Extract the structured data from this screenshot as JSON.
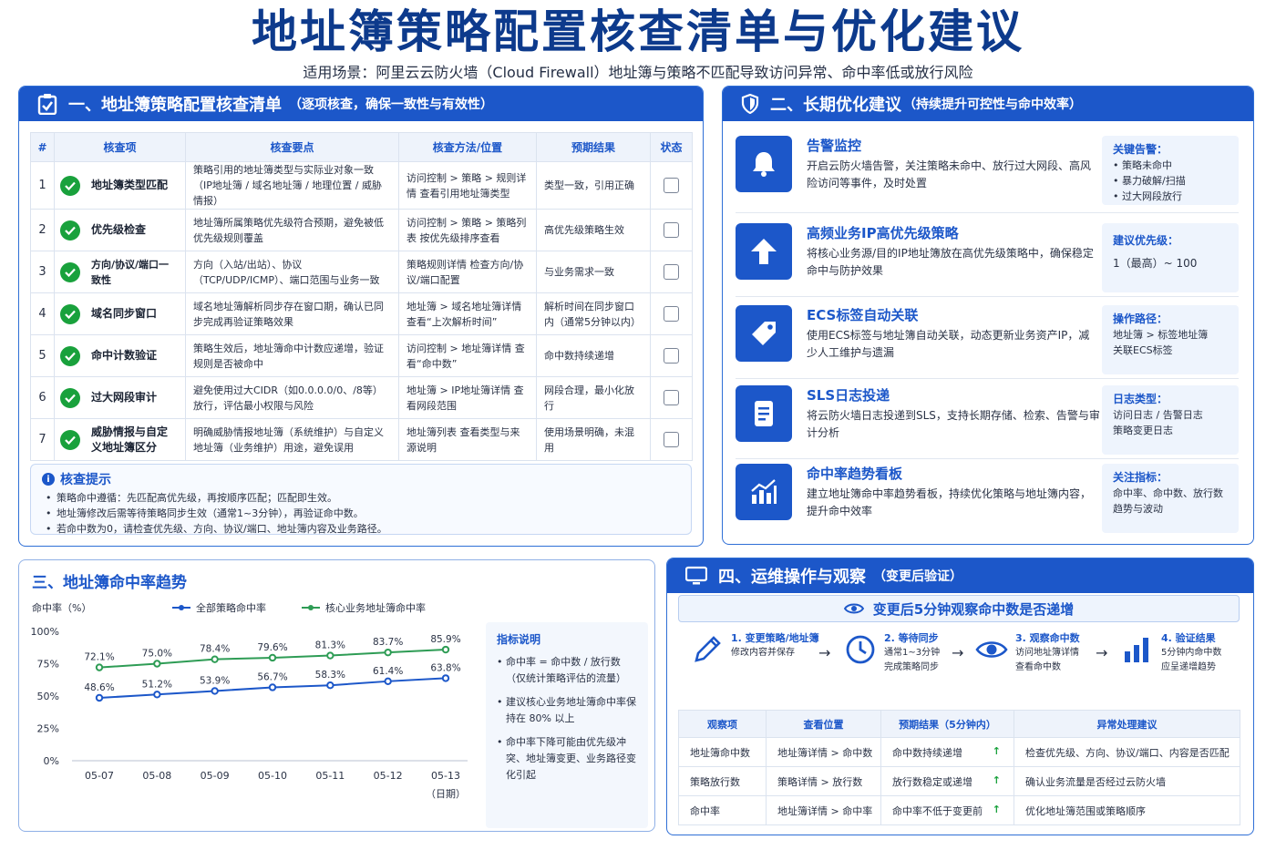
{
  "header": {
    "title": "地址簿策略配置核查清单与优化建议",
    "subtitle": "适用场景：阿里云云防火墙（Cloud Firewall）地址簿与策略不匹配导致访问异常、命中率低或放行风险"
  },
  "checklist": {
    "title": "一、地址簿策略配置核查清单",
    "title_sub": "（逐项核查，确保一致性与有效性）",
    "columns": [
      "#",
      "核查项",
      "核查要点",
      "核查方法/位置",
      "预期结果",
      "状态"
    ],
    "rows": [
      {
        "num": "1",
        "item": "地址簿类型匹配",
        "point": "策略引用的地址簿类型与实际业对象一致（IP地址簿 / 域名地址簿 / 地理位置 / 威胁情报）",
        "method": "访问控制 > 策略 > 规则详情 查看引用地址簿类型",
        "expect": "类型一致，引用正确"
      },
      {
        "num": "2",
        "item": "优先级检查",
        "point": "地址簿所属策略优先级符合预期，避免被低优先级规则覆盖",
        "method": "访问控制 > 策略 > 策略列表 按优先级排序查看",
        "expect": "高优先级策略生效"
      },
      {
        "num": "3",
        "item": "方向/协议/端口一致性",
        "point": "方向（入站/出站）、协议（TCP/UDP/ICMP）、端口范围与业务一致",
        "method": "策略规则详情 检查方向/协议/端口配置",
        "expect": "与业务需求一致"
      },
      {
        "num": "4",
        "item": "域名同步窗口",
        "point": "域名地址簿解析同步存在窗口期，确认已同步完成再验证策略效果",
        "method": "地址簿 > 域名地址簿详情 查看“上次解析时间”",
        "expect": "解析时间在同步窗口内（通常5分钟以内）"
      },
      {
        "num": "5",
        "item": "命中计数验证",
        "point": "策略生效后，地址簿命中计数应递增，验证规则是否被命中",
        "method": "访问控制 > 地址簿详情 查看“命中数”",
        "expect": "命中数持续递增"
      },
      {
        "num": "6",
        "item": "过大网段审计",
        "point": "避免使用过大CIDR（如0.0.0.0/0、/8等）放行，评估最小权限与风险",
        "method": "地址簿 > IP地址簿详情 查看网段范围",
        "expect": "网段合理，最小化放行"
      },
      {
        "num": "7",
        "item": "威胁情报与自定义地址簿区分",
        "point": "明确威胁情报地址簿（系统维护）与自定义地址簿（业务维护）用途，避免误用",
        "method": "地址簿列表 查看类型与来源说明",
        "expect": "使用场景明确，未混用"
      }
    ],
    "tips": {
      "title": "核查提示",
      "items": [
        "策略命中遵循：先匹配高优先级，再按顺序匹配；匹配即生效。",
        "地址簿修改后需等待策略同步生效（通常1~3分钟），再验证命中数。",
        "若命中数为0，请检查优先级、方向、协议/端口、地址簿内容及业务路径。"
      ]
    }
  },
  "optimization": {
    "title": "二、长期优化建议",
    "title_sub": "（持续提升可控性与命中效率）",
    "cards": [
      {
        "icon": "bell-icon",
        "title": "告警监控",
        "desc": "开启云防火墙告警，关注策略未命中、放行过大网段、高风险访问等事件，及时处置",
        "side_title": "关键告警：",
        "side_items": [
          "• 策略未命中",
          "• 暴力破解/扫描",
          "• 过大网段放行"
        ]
      },
      {
        "icon": "arrow-up-icon",
        "title": "高频业务IP高优先级策略",
        "desc": "将核心业务源/目的IP地址簿放在高优先级策略中，确保稳定命中与防护效果",
        "side_title": "建议优先级：",
        "side_items": [
          "1（最高）~ 100"
        ]
      },
      {
        "icon": "tag-icon",
        "title": "ECS标签自动关联",
        "desc": "使用ECS标签与地址簿自动关联，动态更新业务资产IP，减少人工维护与遗漏",
        "side_title": "操作路径：",
        "side_items": [
          "地址簿 > 标签地址簿",
          "关联ECS标签"
        ]
      },
      {
        "icon": "document-icon",
        "title": "SLS日志投递",
        "desc": "将云防火墙日志投递到SLS，支持长期存储、检索、告警与审计分析",
        "side_title": "日志类型：",
        "side_items": [
          "访问日志 / 告警日志",
          "策略变更日志"
        ]
      },
      {
        "icon": "chart-icon",
        "title": "命中率趋势看板",
        "desc": "建立地址簿命中率趋势看板，持续优化策略与地址簿内容，提升命中效率",
        "side_title": "关注指标：",
        "side_items": [
          "命中率、命中数、放行数",
          "趋势与波动"
        ]
      }
    ]
  },
  "trend": {
    "title": "三、地址簿命中率趋势",
    "notes": {
      "title": "指标说明",
      "items": [
        "命中率 = 命中数 / 放行数（仅统计策略评估的流量）",
        "建议核心业务地址簿命中率保持在 80% 以上",
        "命中率下降可能由优先级冲突、地址簿变更、业务路径变化引起"
      ]
    }
  },
  "chart_data": {
    "type": "line",
    "ylabel": "命中率（%）",
    "xlabel": "（日期）",
    "categories": [
      "05-07",
      "05-08",
      "05-09",
      "05-10",
      "05-11",
      "05-12",
      "05-13"
    ],
    "yticks": [
      "0%",
      "25%",
      "50%",
      "75%",
      "100%"
    ],
    "ylim": [
      0,
      100
    ],
    "series": [
      {
        "name": "全部策略命中率",
        "color": "#1c57c9",
        "values": [
          48.6,
          51.2,
          53.9,
          56.7,
          58.3,
          61.4,
          63.8
        ],
        "labels": [
          "48.6%",
          "51.2%",
          "53.9%",
          "56.7%",
          "58.3%",
          "61.4%",
          "63.8%"
        ]
      },
      {
        "name": "核心业务地址簿命中率",
        "color": "#2e9c55",
        "values": [
          72.1,
          75.0,
          78.4,
          79.6,
          81.3,
          83.7,
          85.9
        ],
        "labels": [
          "72.1%",
          "75.0%",
          "78.4%",
          "79.6%",
          "81.3%",
          "83.7%",
          "85.9%"
        ]
      }
    ],
    "grid": false,
    "legend": "top"
  },
  "ops": {
    "title": "四、运维操作与观察",
    "title_sub": "（变更后验证）",
    "banner": "变更后5分钟观察命中数是否递增",
    "steps": [
      {
        "icon": "pencil-icon",
        "title": "1. 变更策略/地址簿",
        "desc": [
          "修改内容并保存"
        ]
      },
      {
        "icon": "clock-icon",
        "title": "2. 等待同步",
        "desc": [
          "通常1~3分钟",
          "完成策略同步"
        ]
      },
      {
        "icon": "eye-icon",
        "title": "3. 观察命中数",
        "desc": [
          "访问地址簿详情",
          "查看命中数"
        ]
      },
      {
        "icon": "bar-chart-icon",
        "title": "4. 验证结果",
        "desc": [
          "5分钟内命中数",
          "应呈递增趋势"
        ]
      }
    ],
    "columns": [
      "观察项",
      "查看位置",
      "预期结果（5分钟内）",
      "异常处理建议"
    ],
    "rows": [
      {
        "item": "地址簿命中数",
        "where": "地址簿详情 > 命中数",
        "expect": "命中数持续递增",
        "advice": "检查优先级、方向、协议/端口、内容是否匹配"
      },
      {
        "item": "策略放行数",
        "where": "策略详情 > 放行数",
        "expect": "放行数稳定或递增",
        "advice": "确认业务流量是否经过云防火墙"
      },
      {
        "item": "命中率",
        "where": "地址簿详情 > 命中率",
        "expect": "命中率不低于变更前",
        "advice": "优化地址簿范围或策略顺序"
      }
    ],
    "up_arrow": "↑"
  }
}
